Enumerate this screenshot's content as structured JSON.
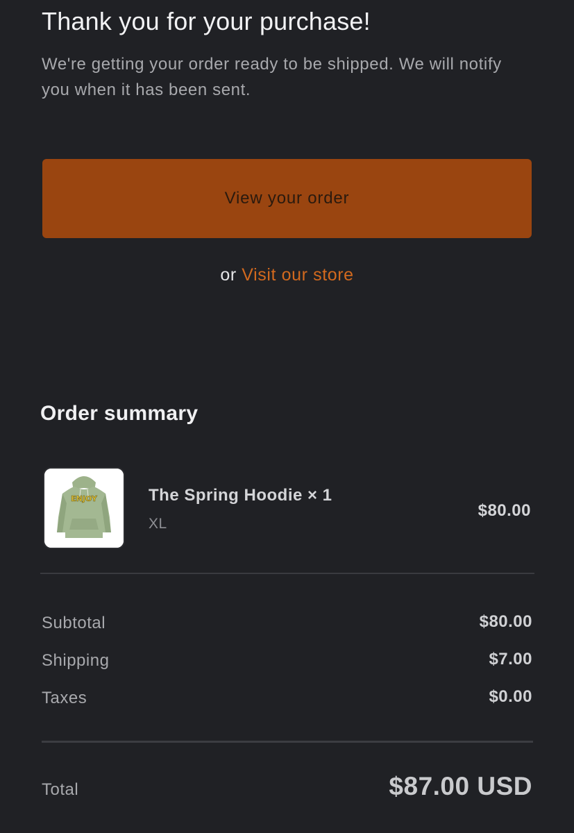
{
  "header": {
    "title": "Thank you for your purchase!",
    "message": "We're getting your order ready to be shipped. We will notify you when it has been sent."
  },
  "actions": {
    "view_order_label": "View your order",
    "or_text": "or",
    "visit_store_label": "Visit our store"
  },
  "summary": {
    "title": "Order summary",
    "items": [
      {
        "name": "The Spring Hoodie × 1",
        "variant": "XL",
        "price": "$80.00",
        "image_icon": "green-hoodie-image"
      }
    ],
    "subtotal": {
      "label": "Subtotal",
      "value": "$80.00"
    },
    "shipping": {
      "label": "Shipping",
      "value": "$7.00"
    },
    "taxes": {
      "label": "Taxes",
      "value": "$0.00"
    },
    "total": {
      "label": "Total",
      "value": "$87.00 USD"
    }
  },
  "colors": {
    "background": "#202125",
    "accent": "#9a4510",
    "link": "#d2691e"
  }
}
